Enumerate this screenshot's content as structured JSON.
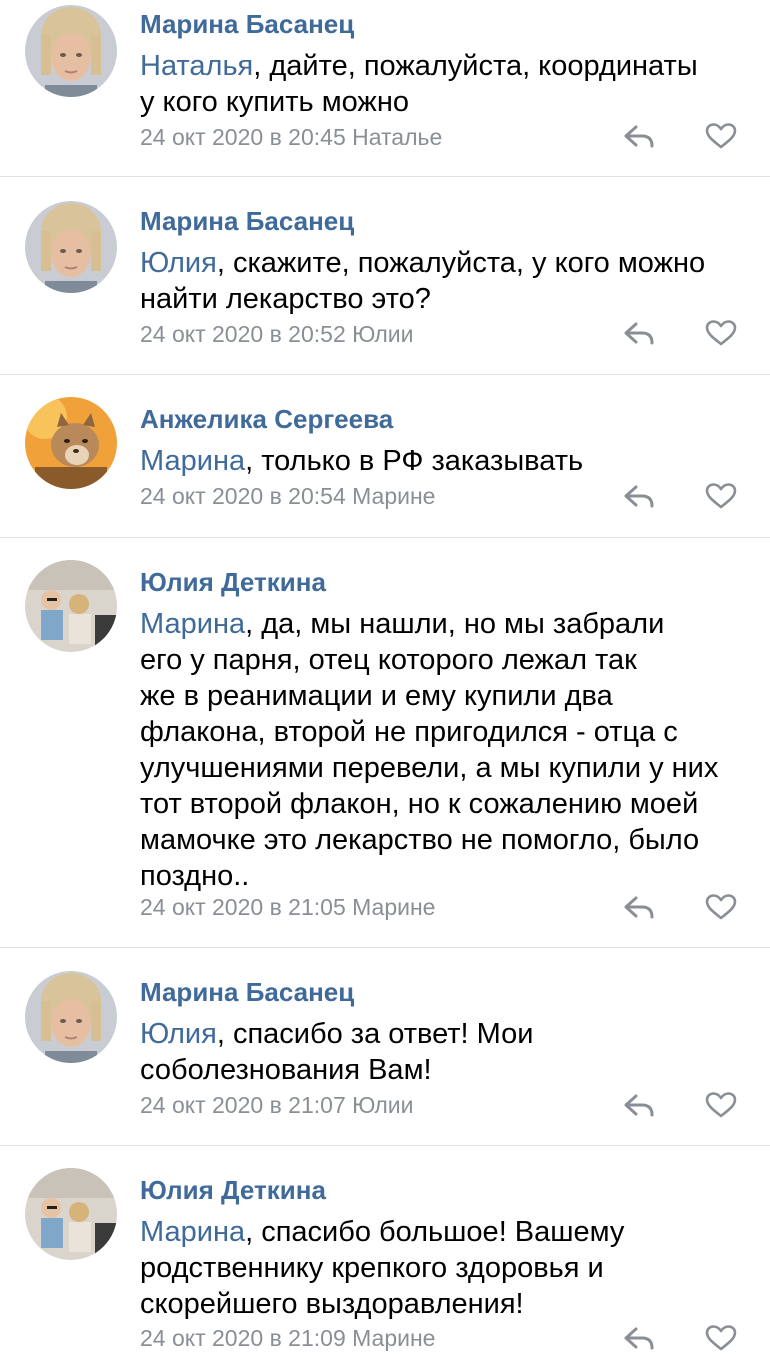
{
  "colors": {
    "author": "#3f6a9a",
    "text": "#000000",
    "meta": "#8a8f96",
    "divider": "#dfe1e5"
  },
  "comments": [
    {
      "author": "Марина Басанец",
      "reply_to": "Наталья",
      "text_lines": [
        ", дайте, пожалуйста, координаты",
        "у кого купить можно"
      ],
      "meta": "24 окт 2020 в 20:45 Наталье",
      "avatar": "avatar-woman-icon"
    },
    {
      "author": "Марина Басанец",
      "reply_to": "Юлия",
      "text_lines": [
        ", скажите, пожалуйста, у кого можно",
        "найти лекарство это?"
      ],
      "meta": "24 окт 2020 в 20:52 Юлии",
      "avatar": "avatar-woman-icon"
    },
    {
      "author": "Анжелика Сергеева",
      "reply_to": "Марина",
      "text_lines": [
        ", только в РФ заказывать"
      ],
      "meta": "24 окт 2020 в 20:54 Марине",
      "avatar": "avatar-cougar-icon"
    },
    {
      "author": "Юлия Деткина",
      "reply_to": "Марина",
      "text_lines": [
        ", да, мы нашли, но мы забрали",
        "его у парня, отец которого лежал так",
        "же в реанимации и ему купили два",
        "флакона, второй не пригодился - отца с",
        "улучшениями перевели, а мы купили у них",
        "тот второй  флакон, но к сожалению моей",
        "мамочке это лекарство не помогло, было",
        "поздно.."
      ],
      "meta": "24 окт 2020 в 21:05 Марине",
      "avatar": "avatar-children-icon"
    },
    {
      "author": "Марина Басанец",
      "reply_to": "Юлия",
      "text_lines": [
        ", спасибо за ответ! Мои",
        "соболезнования Вам!"
      ],
      "meta": "24 окт 2020 в 21:07 Юлии",
      "avatar": "avatar-woman-icon"
    },
    {
      "author": "Юлия Деткина",
      "reply_to": "Марина",
      "text_lines": [
        ", спасибо большое! Вашему",
        "родственнику крепкого здоровья и",
        "скорейшего выздоравления!"
      ],
      "meta": "24 окт 2020 в 21:09 Марине",
      "avatar": "avatar-children-icon"
    }
  ],
  "icons": {
    "reply": "reply-arrow-icon",
    "like": "heart-outline-icon"
  }
}
